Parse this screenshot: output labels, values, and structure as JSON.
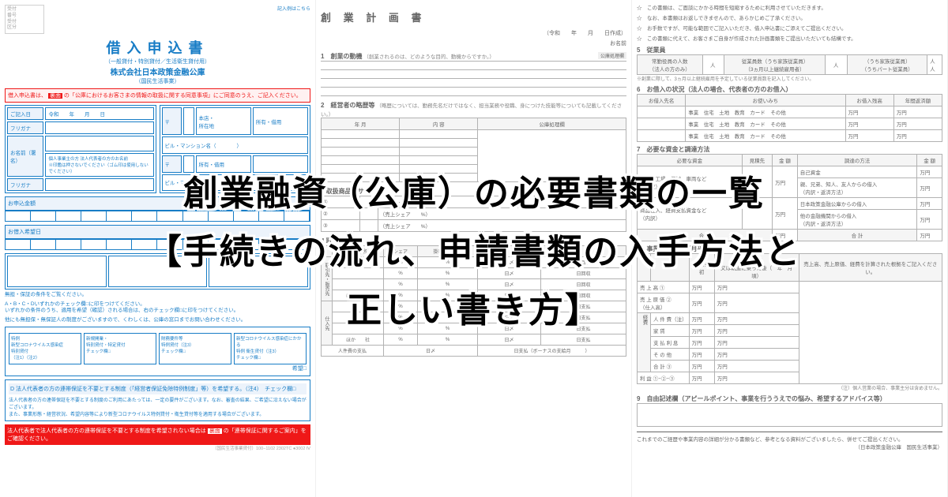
{
  "overlay": {
    "line1": "創業融資（公庫）の必要書類の一覧",
    "line2": "【手続きの流れ、申請書類の入手方法と",
    "line3": "正しい書き方】"
  },
  "col1": {
    "reception_lines": "受付\n番号\n受付\n区分",
    "form_title": "借入申込書",
    "subtitle": "（一般貸付・特別貸付／生活衛生貸付用）",
    "company": "株式会社日本政策金融公庫",
    "sub2": "（国民生活事業）",
    "entry_guide_top": "記入例はこちら",
    "red_guide_pre": "借入申込書は、",
    "red_guide_badge": "裏面",
    "red_guide_post": "の「公庫におけるお客さまの情報の取扱に関する同意事項」にご同意のうえ、ご記入ください。",
    "entry_date_label": "ご記入日",
    "entry_date_fmt": "令和　　年　　月　　日",
    "postal_label": "〒",
    "home_office": "本店・\n所在地",
    "owned_label": "所有・借用",
    "furigana": "フリガナ",
    "building": "ビル・マンション名（　　　　）",
    "name_box_label": "お名前（署名）",
    "owner_note": "個人事業主の方 法人代表者の方のお名前\n※印鑑は押さないでください（ゴム印は使用しないでください）",
    "amount_label": "お申込金額",
    "amount_unit": "万円",
    "desired_label": "お借入希望日",
    "conditions_hdr": "無担・保証の条件をご覧ください。",
    "conditions_note": "A・B・C・Dいずれかのチェック欄□に印をつけてください。\nいずれかの条件のうち、適用を希望（確認）される場合は、右のチェック欄□に印をつけてください。",
    "other_note": "他にも無担保・無保証人の制度がございますので、くわしくは、公庫の窓口までお問い合わせください。",
    "box_a": "特例\n新型コロナウイルス感染症\n特別貸付\n（注1）（注2）",
    "box_b": "新規開業・\n特別貸付・特定貸付\nチェック欄□",
    "box_c": "財務要件等\n特例貸付（注3）\nチェック欄□",
    "box_d": "新型コロナウイルス感染症にかかる\n特例 衛生貸付（注3）\nチェック欄□",
    "hope_label": "希望□",
    "d_hdr": "D 法人代表者の方の連帯保証を不要とする制度（「経営者保証免除特例制度」等）を希望する。（注4）　チェック欄□",
    "d_note": "法人代表者の方の連帯保証を不要とする制度のご利用にあたっては、一定の要件がございます。なお、審査の結果、ご希望に沿えない場合がございます。\nまた、事業形態・経営状況、希望内容等により新型コロナウイルス特例貸付・衛生貸付等を適用する場合がございます。",
    "bottom_red_pre": "法人代表者で法人代表者の方の連帯保証を不要とする制度を希望されない場合は",
    "bottom_red_badge": "裏面",
    "bottom_red_post": "の「連帯保証に関するご案内」をご確認ください。",
    "tiny_right": "（国民生活事業貸付）100−1102 2302TC ●3002 Ⅳ"
  },
  "col2": {
    "title": "創 業 計 画 書",
    "date_fmt": "（令和　　年　　月　　日作成）",
    "name_label": "お名前",
    "s1_h": "1　創業の動機",
    "s1_sub": "（創業されるのは、どのような目的、動機からですか。）",
    "proc_tag": "公庫処理欄",
    "s2_h": "2　経営者の略歴等",
    "s2_sub": "（略歴については、勤務先名だけではなく、担当業務や役職、身につけた技能等についても記載してください。）",
    "career_cols": [
      "年 月",
      "内 容",
      "公庫処理欄"
    ],
    "s3_h": "3 取扱商品・サービス",
    "s3_rows": [
      "①",
      "②",
      "③"
    ],
    "share_label": "（売上シェア　　%）",
    "s4_h": "4 取引関係等",
    "deal_cols": [
      "取引先名",
      "シェア",
      "掛取引の割合",
      "回収・支払の条件"
    ],
    "side_sell": "取引先・販売先",
    "side_buy": "仕入先",
    "hoka": "ほか　　社",
    "pct": "%",
    "close": "日〆",
    "recv": "日回収",
    "pay": "日支払",
    "personnel_pay": "人件費の支払",
    "bottom_pay": "日支払（ボーナスの支給月　　　）"
  },
  "col3": {
    "star1": "☆　この書類は、ご面談にかかる時間を短縮するために利用させていただきます。",
    "star2": "☆　なお、本書類はお返しできませんので、あらかじめご了承ください。",
    "star3": "☆　お手数ですが、可能な範囲でご記入いただき、借入申込書にご添えてご提出ください。",
    "star4": "☆　この書類に代えて、お客さまご自身が作成された計画書類をご提出いただいても結構です。",
    "s5_h": "5　従業員",
    "emp_cols": [
      "常勤役員の人数\n（法人の方のみ）",
      "　人",
      "従業員数（うち家族従業員）\n（3ヵ月以上継続雇用者）",
      "　人",
      "（うち家族従業員）\n（うちパート従業員）",
      "人\n人"
    ],
    "emp_note": "※創業に際して、3ヵ月以上継続雇用を予定している従業員数を記入してください。",
    "s6_h": "6　お借入の状況（法人の場合、代表者の方のお借入）",
    "s6_cols": [
      "お借入先名",
      "お使いみち",
      "お借入残高",
      "年間返済額"
    ],
    "s6_use": "事業　住宅　土地　教育　カード　その他",
    "yen": "万円",
    "s7_h": "7　必要な資金と調達方法",
    "s7_left_cols": [
      "必要な資金",
      "見積先",
      "金 額"
    ],
    "s7_right_cols": [
      "調達の方法",
      "金 額"
    ],
    "s7_row1": "店舗、工場、機械、車両など\n（内訳）",
    "s7_row2": "商品仕入、経費支払資金など\n（内訳）",
    "s7_r1": "自己資金",
    "s7_r2": "親、兄弟、知人、友人からの借入\n（内訳・返済方法）",
    "s7_r3": "日本政策金融公庫からの借入",
    "s7_r4": "他の金融機関からの借入\n（内訳・返済方法）",
    "s7_sum": "合 計",
    "s8_h": "8　事業の見通し（月平均）",
    "s8_cols": [
      "",
      "創業当初",
      "1年後\n又は軌道に乗った後（　年　月頃）",
      "売上高、売上原価、経費を計算された根拠をご記入ください。"
    ],
    "s8_rows": [
      "売 上 高 ①",
      "売 上 原 価 ②\n（仕入高）",
      "人 件 費（注）",
      "家 賃",
      "支 払 利 息",
      "そ の 他",
      "合 計 ③",
      "利 益 ①−②−③"
    ],
    "s8_side": "経費",
    "s8_note": "（注）個人営業の場合、事業主分は含めません。",
    "s9_h": "9　自由記述欄（アピールポイント、事業を行ううえでの悩み、希望するアドバイス等）",
    "footer": "これまでのご経歴や事業内容の詳細が分かる書類など、参考となる資料がございましたら、併せてご提出ください。",
    "footer_org": "（日本政策金融公庫　国民生活事業）"
  }
}
